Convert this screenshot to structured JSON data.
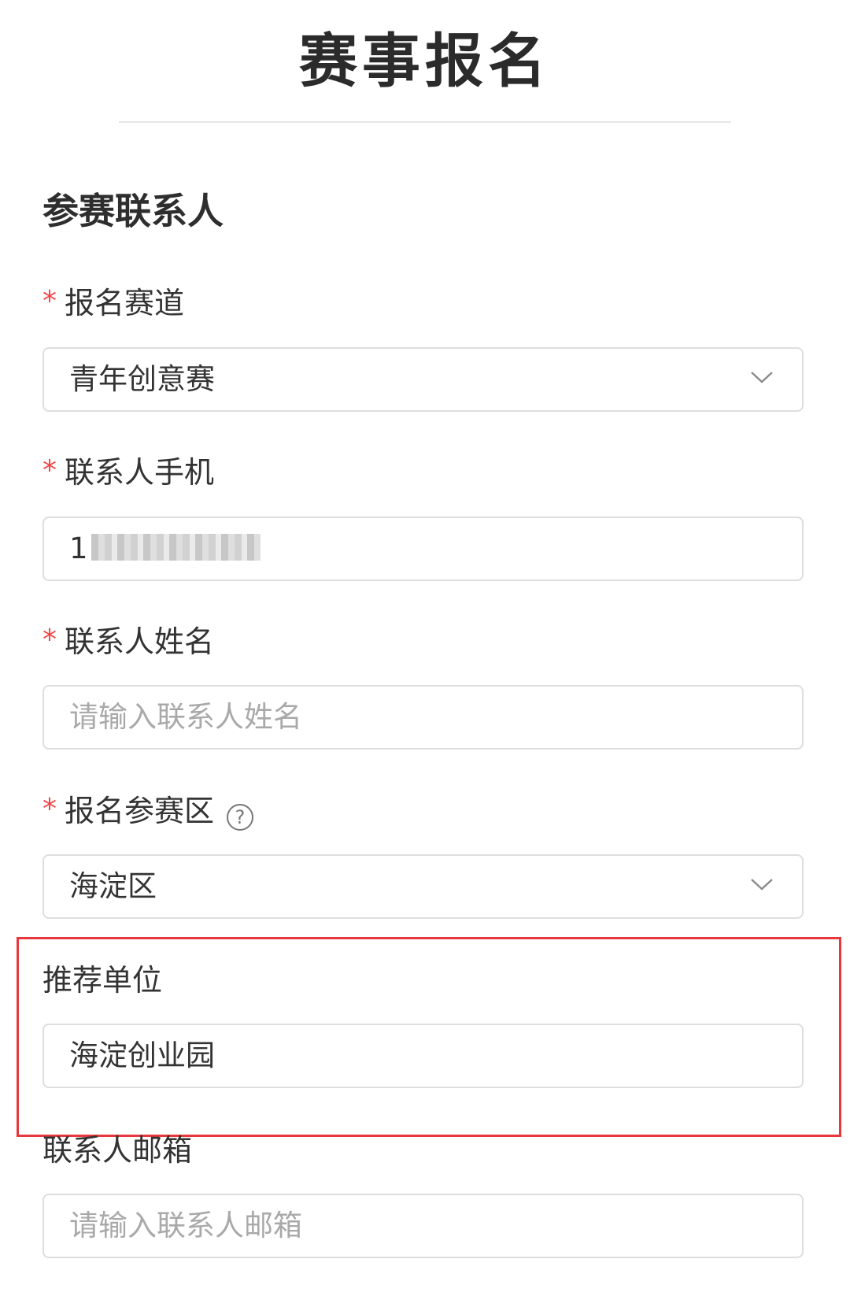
{
  "page": {
    "title": "赛事报名"
  },
  "section": {
    "heading": "参赛联系人"
  },
  "fields": {
    "track": {
      "required_mark": "*",
      "label": "报名赛道",
      "value": "青年创意赛",
      "control": "select"
    },
    "phone": {
      "required_mark": "*",
      "label": "联系人手机",
      "value_visible_prefix": "1",
      "value_obscured": true
    },
    "name": {
      "required_mark": "*",
      "label": "联系人姓名",
      "placeholder": "请输入联系人姓名"
    },
    "district": {
      "required_mark": "*",
      "label": "报名参赛区",
      "help_icon": "question-circle-icon",
      "value": "海淀区",
      "control": "select"
    },
    "recommender": {
      "label": "推荐单位",
      "value": "海淀创业园"
    },
    "email": {
      "label": "联系人邮箱",
      "placeholder": "请输入联系人邮箱"
    }
  },
  "colors": {
    "required": "#f04848",
    "highlight_border": "#e8383d",
    "placeholder": "#a9a9a9",
    "input_border": "#dedede"
  }
}
